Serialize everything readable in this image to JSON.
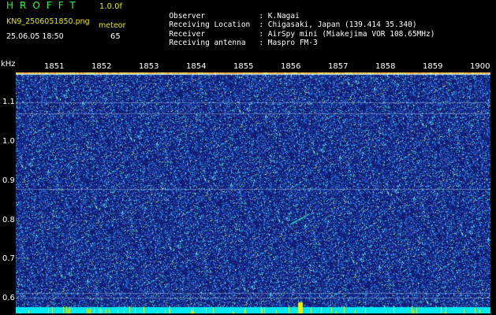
{
  "header": {
    "app_name": "HROFFT",
    "app_version": "1.0.0f",
    "file_name": "KN9_2506051850.png",
    "meteor_label": "meteor",
    "date_time": "25.06.05 18:50",
    "meteor_count": "65"
  },
  "info": [
    {
      "key": "Observer",
      "sep": ":",
      "value": "K.Nagai"
    },
    {
      "key": "Receiving Location",
      "sep": ":",
      "value": "Chigasaki, Japan (139.414 35.340)"
    },
    {
      "key": "Receiver",
      "sep": ":",
      "value": "AirSpy mini (Miakejima VOR 108.65MHz)"
    },
    {
      "key": "Receiving antenna",
      "sep": ":",
      "value": "Maspro FM-3"
    }
  ],
  "axes": {
    "unit_label": "kHz",
    "time_ticks": [
      "1851",
      "1852",
      "1853",
      "1854",
      "1855",
      "1856",
      "1857",
      "1858",
      "1859",
      "1900"
    ],
    "freq_ticks": [
      "1.1",
      "1.0",
      "0.9",
      "0.8",
      "0.7",
      "0.6"
    ]
  },
  "colors": {
    "background": "#000000",
    "header_yellow": "#e8e800",
    "header_green": "#20ff40",
    "noise_base": "#101a6a",
    "signal_band": "#00e8f0",
    "signal_peak": "#f0f000"
  }
}
